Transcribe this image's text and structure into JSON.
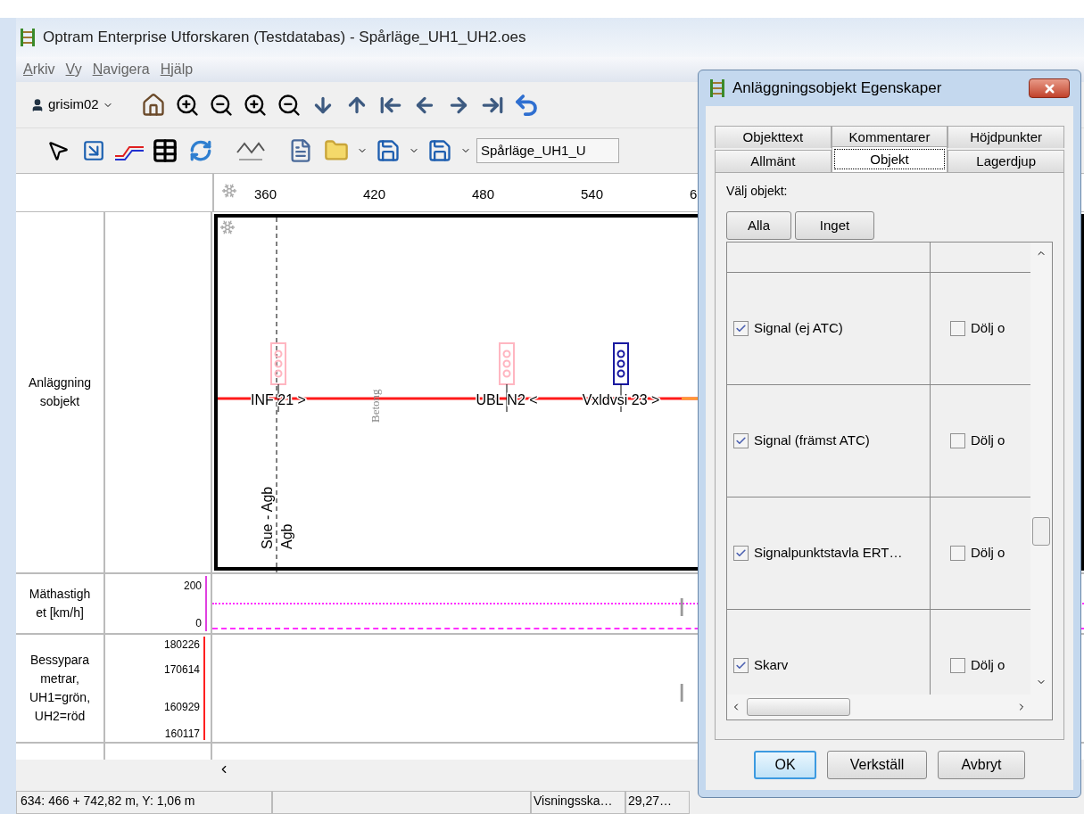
{
  "window": {
    "title": "Optram Enterprise Utforskaren (Testdatabas) - Spårläge_UH1_UH2.oes"
  },
  "menu": [
    {
      "label": "Arkiv"
    },
    {
      "label": "Vy"
    },
    {
      "label": "Navigera"
    },
    {
      "label": "Hjälp"
    }
  ],
  "toolbar": {
    "user": "grisim02",
    "file_combo": "Spårläge_UH1_U"
  },
  "ruler": {
    "ticks": [
      "360",
      "420",
      "480",
      "540",
      "6"
    ]
  },
  "track_panel": {
    "label": "Anläggning\nsobjekt",
    "objects": [
      {
        "kind": "signal",
        "label": "INF 21 >",
        "color": "#ffb6c1"
      },
      {
        "kind": "signal",
        "label": "UBL N2 <",
        "color": "#ffb6c1"
      },
      {
        "kind": "signal",
        "label": "Vxldvsi 23 >",
        "color": "#1a1aa0"
      }
    ],
    "vertical_labels": [
      "Betong",
      "Sue - Agb",
      "Agb"
    ]
  },
  "speed_panel": {
    "label": "Mäthastigh\net [km/h]",
    "axis_labels": [
      "200",
      "0"
    ],
    "note": "I"
  },
  "bessy_panel": {
    "label": "Bessypara\nmetrar,\nUH1=grön,\nUH2=röd",
    "axis_labels": [
      "180226",
      "170614",
      "160929",
      "160117"
    ],
    "note": "I"
  },
  "status_bar": {
    "position": "634: 466 + 742,82 m, Y: 1,06 m",
    "fields": [
      "Visningsska…",
      "29,27…"
    ]
  },
  "dialog": {
    "title": "Anläggningsobjekt Egenskaper",
    "tab_rows": [
      [
        {
          "label": "Objekttext",
          "selected": false
        },
        {
          "label": "Kommentarer",
          "selected": false
        },
        {
          "label": "Höjdpunkter",
          "selected": false
        }
      ],
      [
        {
          "label": "Allmänt",
          "selected": false
        },
        {
          "label": "Objekt",
          "selected": true
        },
        {
          "label": "Lagerdjup",
          "selected": false
        }
      ]
    ],
    "prompt": "Välj objekt:",
    "select_buttons": [
      "Alla",
      "Inget"
    ],
    "rows": [
      {
        "label": "Signal (ej ATC)",
        "checked": true,
        "hide_label": "Dölj o",
        "hide_checked": false
      },
      {
        "label": "Signal (främst ATC)",
        "checked": true,
        "hide_label": "Dölj o",
        "hide_checked": false
      },
      {
        "label": "Signalpunktstavla ERT…",
        "checked": true,
        "hide_label": "Dölj o",
        "hide_checked": false
      },
      {
        "label": "Skarv",
        "checked": true,
        "hide_label": "Dölj o",
        "hide_checked": false
      }
    ],
    "buttons": [
      {
        "label": "OK",
        "default": true
      },
      {
        "label": "Verkställ",
        "default": false
      },
      {
        "label": "Avbryt",
        "default": false
      }
    ]
  }
}
